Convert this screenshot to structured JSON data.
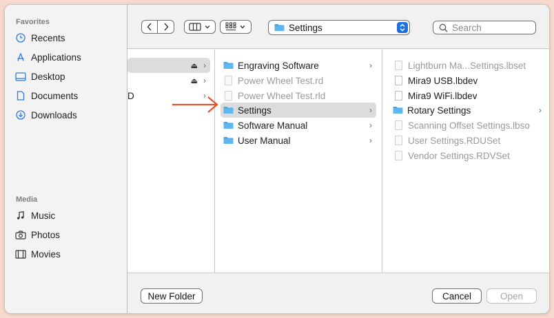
{
  "sidebar": {
    "favorites_title": "Favorites",
    "favorites": [
      {
        "label": "Recents",
        "icon": "clock-icon"
      },
      {
        "label": "Applications",
        "icon": "applications-icon"
      },
      {
        "label": "Desktop",
        "icon": "desktop-icon"
      },
      {
        "label": "Documents",
        "icon": "document-icon"
      },
      {
        "label": "Downloads",
        "icon": "download-icon"
      }
    ],
    "media_title": "Media",
    "media": [
      {
        "label": "Music",
        "icon": "music-note-icon"
      },
      {
        "label": "Photos",
        "icon": "camera-icon"
      },
      {
        "label": "Movies",
        "icon": "film-icon"
      }
    ]
  },
  "toolbar": {
    "location": "Settings",
    "search_placeholder": "Search"
  },
  "browser": {
    "col1": [
      {
        "label": "",
        "eject": true,
        "chevron": true,
        "selected": true
      },
      {
        "label": "",
        "eject": true,
        "chevron": true
      },
      {
        "label": "D",
        "eject": false,
        "chevron": true
      }
    ],
    "col2": [
      {
        "label": "Engraving Software",
        "type": "folder",
        "chevron": true
      },
      {
        "label": "Power Wheel Test.rd",
        "type": "file",
        "dim": true
      },
      {
        "label": "Power Wheel Test.rld",
        "type": "file",
        "dim": true
      },
      {
        "label": "Settings",
        "type": "folder",
        "chevron": true,
        "selected": true
      },
      {
        "label": "Software Manual",
        "type": "folder",
        "chevron": true
      },
      {
        "label": "User Manual",
        "type": "folder",
        "chevron": true
      }
    ],
    "col3": [
      {
        "label": "Lightburn Ma...Settings.lbset",
        "type": "file",
        "dim": true
      },
      {
        "label": "Mira9 USB.lbdev",
        "type": "file"
      },
      {
        "label": "Mira9 WiFi.lbdev",
        "type": "file"
      },
      {
        "label": "Rotary Settings",
        "type": "folder",
        "chevron": true
      },
      {
        "label": "Scanning Offset Settings.lbso",
        "type": "file",
        "dim": true
      },
      {
        "label": "User Settings.RDUSet",
        "type": "file",
        "dim": true
      },
      {
        "label": "Vendor Settings.RDVSet",
        "type": "file",
        "dim": true
      }
    ]
  },
  "footer": {
    "new_folder": "New Folder",
    "cancel": "Cancel",
    "open": "Open"
  },
  "colors": {
    "folder": "#45a7e8",
    "accent": "#1e6fe0",
    "annotation_arrow": "#e5532d"
  }
}
